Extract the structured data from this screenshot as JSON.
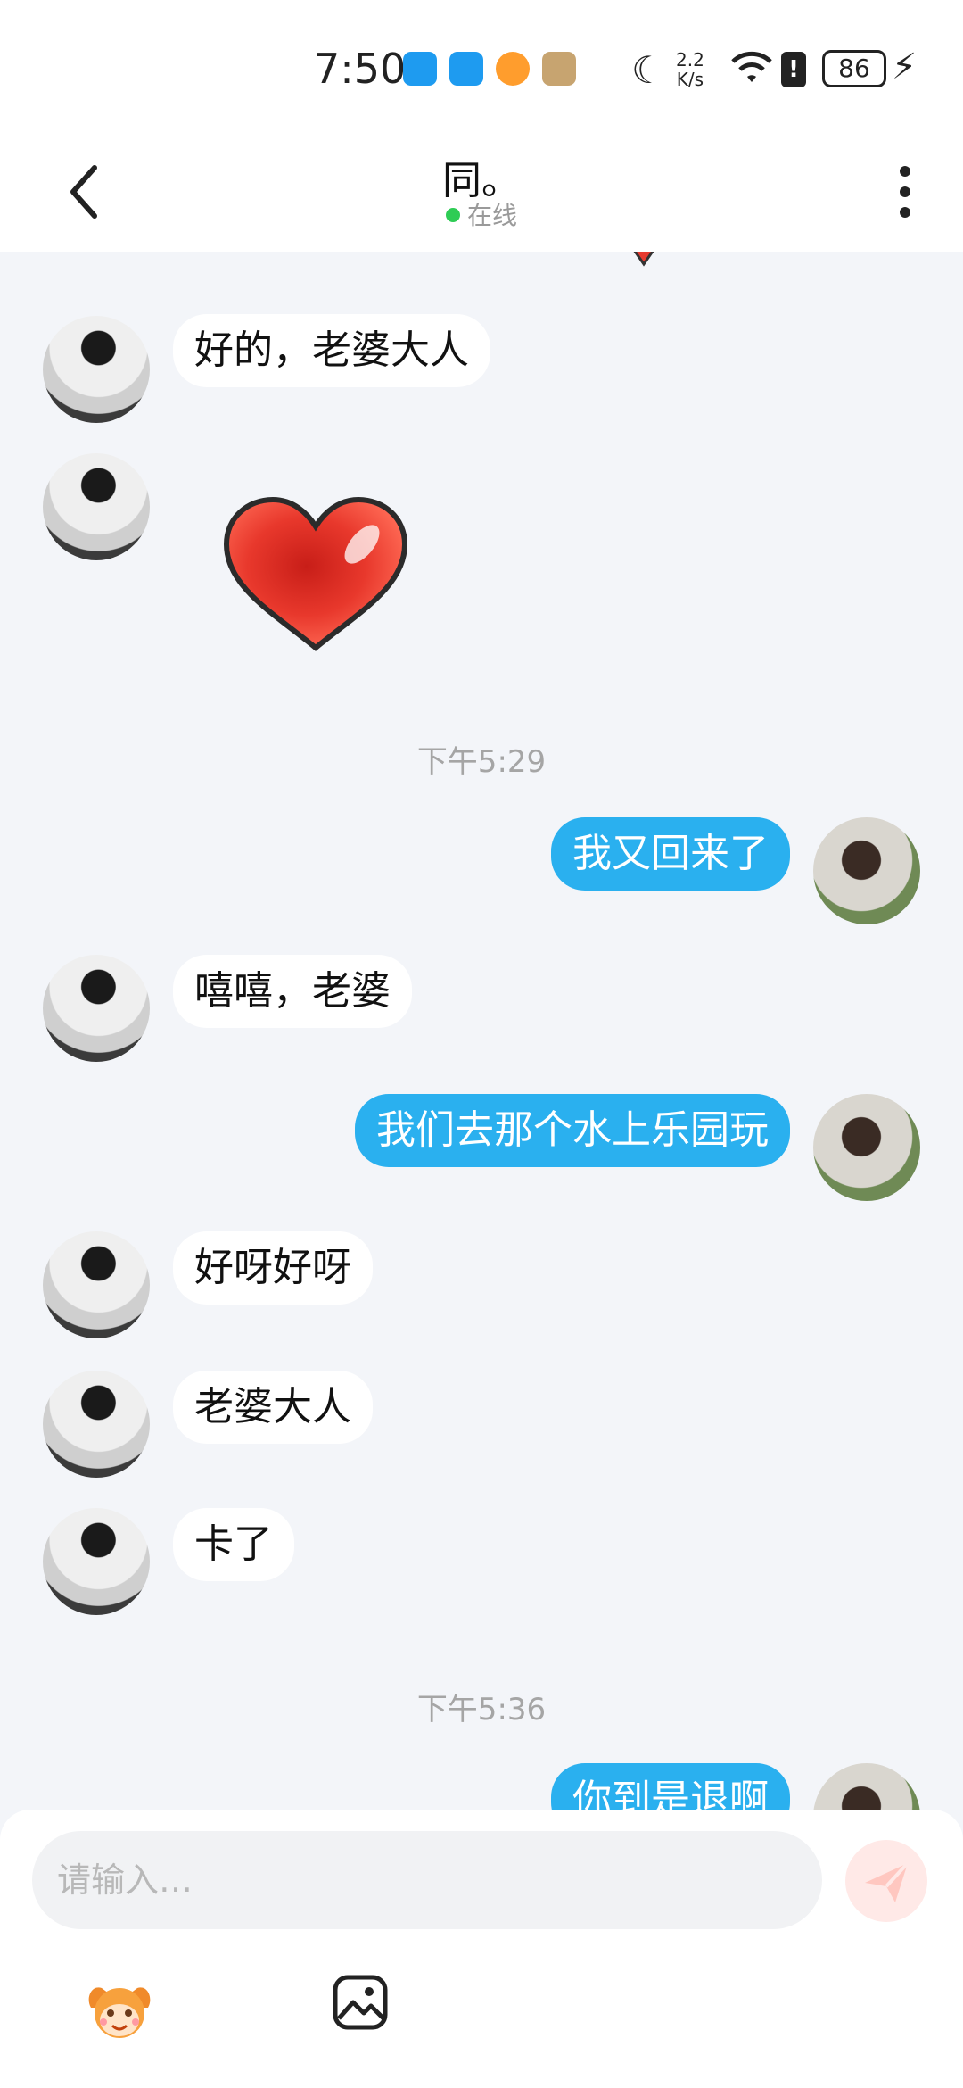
{
  "status_bar": {
    "time": "7:50",
    "network_speed_top": "2.2",
    "network_speed_bottom": "K/s",
    "battery": "86"
  },
  "header": {
    "title": "同。",
    "presence": "在线"
  },
  "messages": [
    {
      "side": "in",
      "text": "好的，老婆大人"
    },
    {
      "side": "in",
      "type": "sticker",
      "sticker": "heart"
    },
    {
      "type": "time",
      "text": "下午5:29"
    },
    {
      "side": "out",
      "text": "我又回来了"
    },
    {
      "side": "in",
      "text": "嘻嘻，老婆"
    },
    {
      "side": "out",
      "text": "我们去那个水上乐园玩"
    },
    {
      "side": "in",
      "text": "好呀好呀"
    },
    {
      "side": "in",
      "text": "老婆大人"
    },
    {
      "side": "in",
      "text": "卡了"
    },
    {
      "type": "time",
      "text": "下午5:36"
    },
    {
      "side": "out",
      "text": "你到是退啊"
    }
  ],
  "input": {
    "placeholder": "请输入…",
    "value": ""
  },
  "icons": {
    "back": "chevron-left-icon",
    "more": "more-vertical-icon",
    "send": "send-icon",
    "emoji": "emoji-sticker-icon",
    "gallery": "image-gallery-icon"
  },
  "colors": {
    "outgoing_bubble": "#2ab0ef",
    "incoming_bubble": "#ffffff",
    "chat_background": "#f3f5f9",
    "online_dot": "#2ecc55",
    "send_button": "#ffe9e7"
  }
}
